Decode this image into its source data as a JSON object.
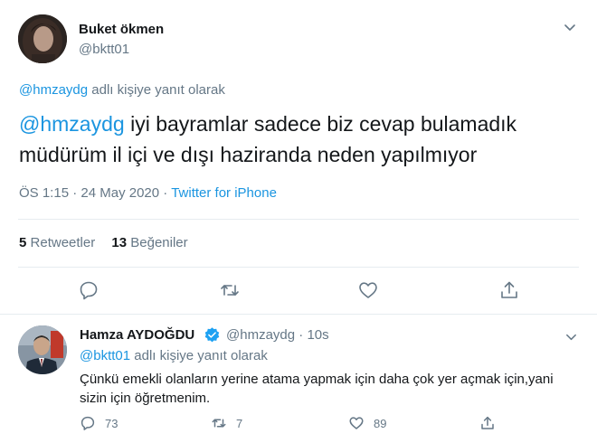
{
  "main_tweet": {
    "author_name": "Buket ökmen",
    "author_handle": "@bktt01",
    "reply_to_handle": "@hmzaydg",
    "reply_to_suffix": "adlı kişiye yanıt olarak",
    "mention": "@hmzaydg",
    "text": "iyi bayramlar sadece biz cevap bulamadık müdürüm il içi ve dışı haziranda neden yapılmıyor",
    "time": "ÖS 1:15",
    "date": "24 May 2020",
    "separator": "·",
    "source": "Twitter for iPhone",
    "retweets_count": "5",
    "retweets_label": "Retweetler",
    "likes_count": "13",
    "likes_label": "Beğeniler"
  },
  "reply_tweet": {
    "author_name": "Hamza AYDOĞDU",
    "author_handle": "@hmzaydg",
    "time_sep": "·",
    "time_ago": "10s",
    "reply_to_handle": "@bktt01",
    "reply_to_suffix": "adlı kişiye yanıt olarak",
    "text": "Çünkü emekli olanların yerine atama yapmak için daha çok yer açmak için,yani sizin için öğretmenim.",
    "replies_count": "73",
    "retweets_count": "7",
    "likes_count": "89"
  },
  "colors": {
    "link": "#1b95e0",
    "muted": "#657786",
    "text": "#14171a",
    "verified": "#1da1f2",
    "divider": "#e6ecf0"
  },
  "icons": {
    "reply": "reply-icon",
    "retweet": "retweet-icon",
    "like": "heart-icon",
    "share": "share-icon",
    "more": "chevron-down-icon",
    "verified": "verified-badge-icon"
  }
}
